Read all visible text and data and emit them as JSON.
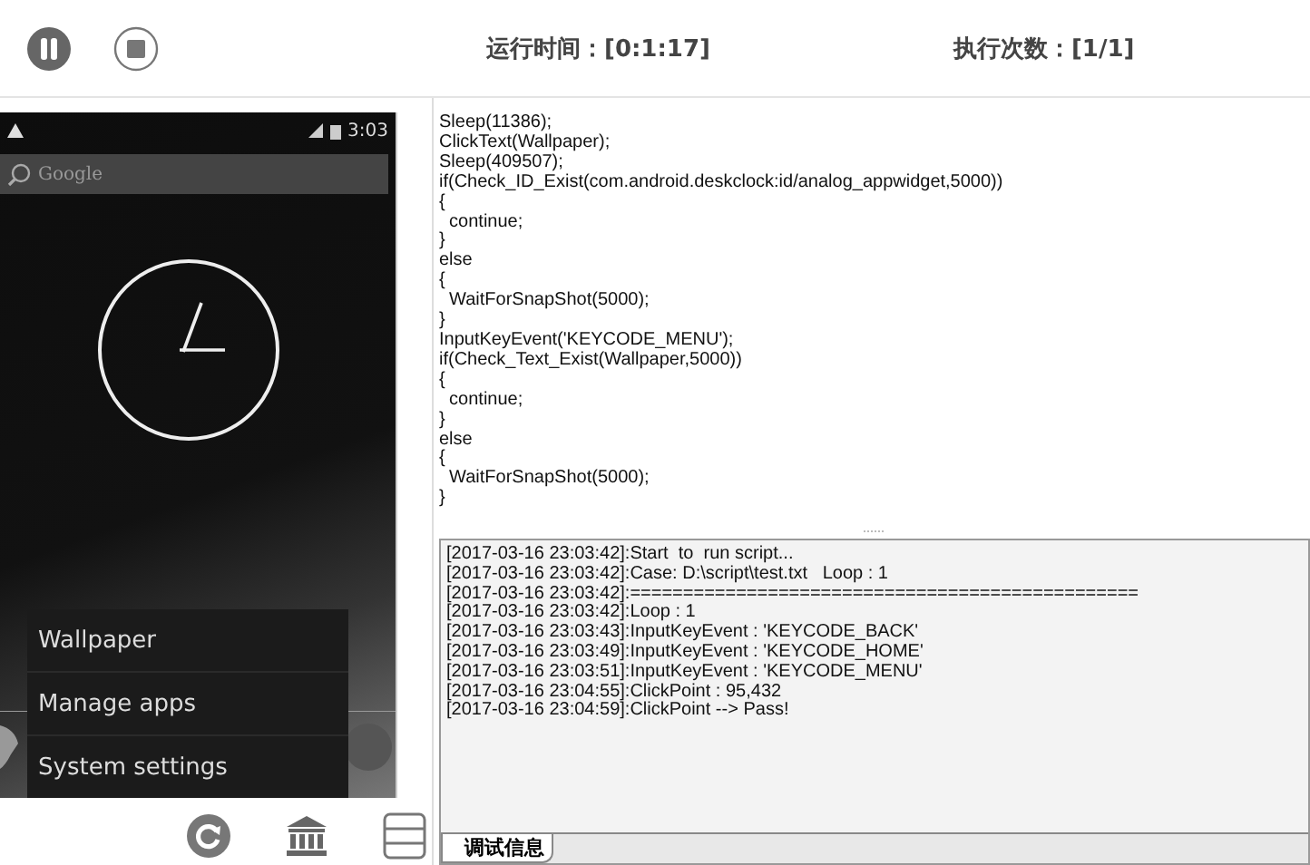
{
  "toolbar": {
    "buttons": [
      {
        "kind": "pause"
      },
      {
        "kind": "stop"
      }
    ],
    "run_time": "运行时间：[0:1:17]",
    "exec_count": "执行次数：[1/1]"
  },
  "device": {
    "status_time": "3:03",
    "search_placeholder": "Google",
    "menu": [
      "Wallpaper",
      "Manage apps",
      "System settings"
    ]
  },
  "device_controls": [
    {
      "kind": "rotate"
    },
    {
      "kind": "home"
    },
    {
      "kind": "layout"
    }
  ],
  "script_lines": [
    "Sleep(11386);",
    "ClickText(Wallpaper);",
    "Sleep(409507);",
    "if(Check_ID_Exist(com.android.deskclock:id/analog_appwidget,5000))",
    "{",
    "  continue;",
    "}",
    "else",
    "{",
    "  WaitForSnapShot(5000);",
    "}",
    "InputKeyEvent('KEYCODE_MENU');",
    "if(Check_Text_Exist(Wallpaper,5000))",
    "{",
    "  continue;",
    "}",
    "else",
    "{",
    "  WaitForSnapShot(5000);",
    "}"
  ],
  "log_lines": [
    "[2017-03-16 23:03:42]:Start  to  run script...",
    "[2017-03-16 23:03:42]:Case: D:\\script\\test.txt   Loop : 1",
    "[2017-03-16 23:03:42]:================================================",
    "[2017-03-16 23:03:42]:Loop : 1",
    "[2017-03-16 23:03:43]:InputKeyEvent : 'KEYCODE_BACK'",
    "[2017-03-16 23:03:49]:InputKeyEvent : 'KEYCODE_HOME'",
    "[2017-03-16 23:03:51]:InputKeyEvent : 'KEYCODE_MENU'",
    "[2017-03-16 23:04:55]:ClickPoint : 95,432",
    "[2017-03-16 23:04:59]:ClickPoint --> Pass!"
  ],
  "log_tabs": [
    {
      "label": "调试信息",
      "selected": true
    }
  ]
}
